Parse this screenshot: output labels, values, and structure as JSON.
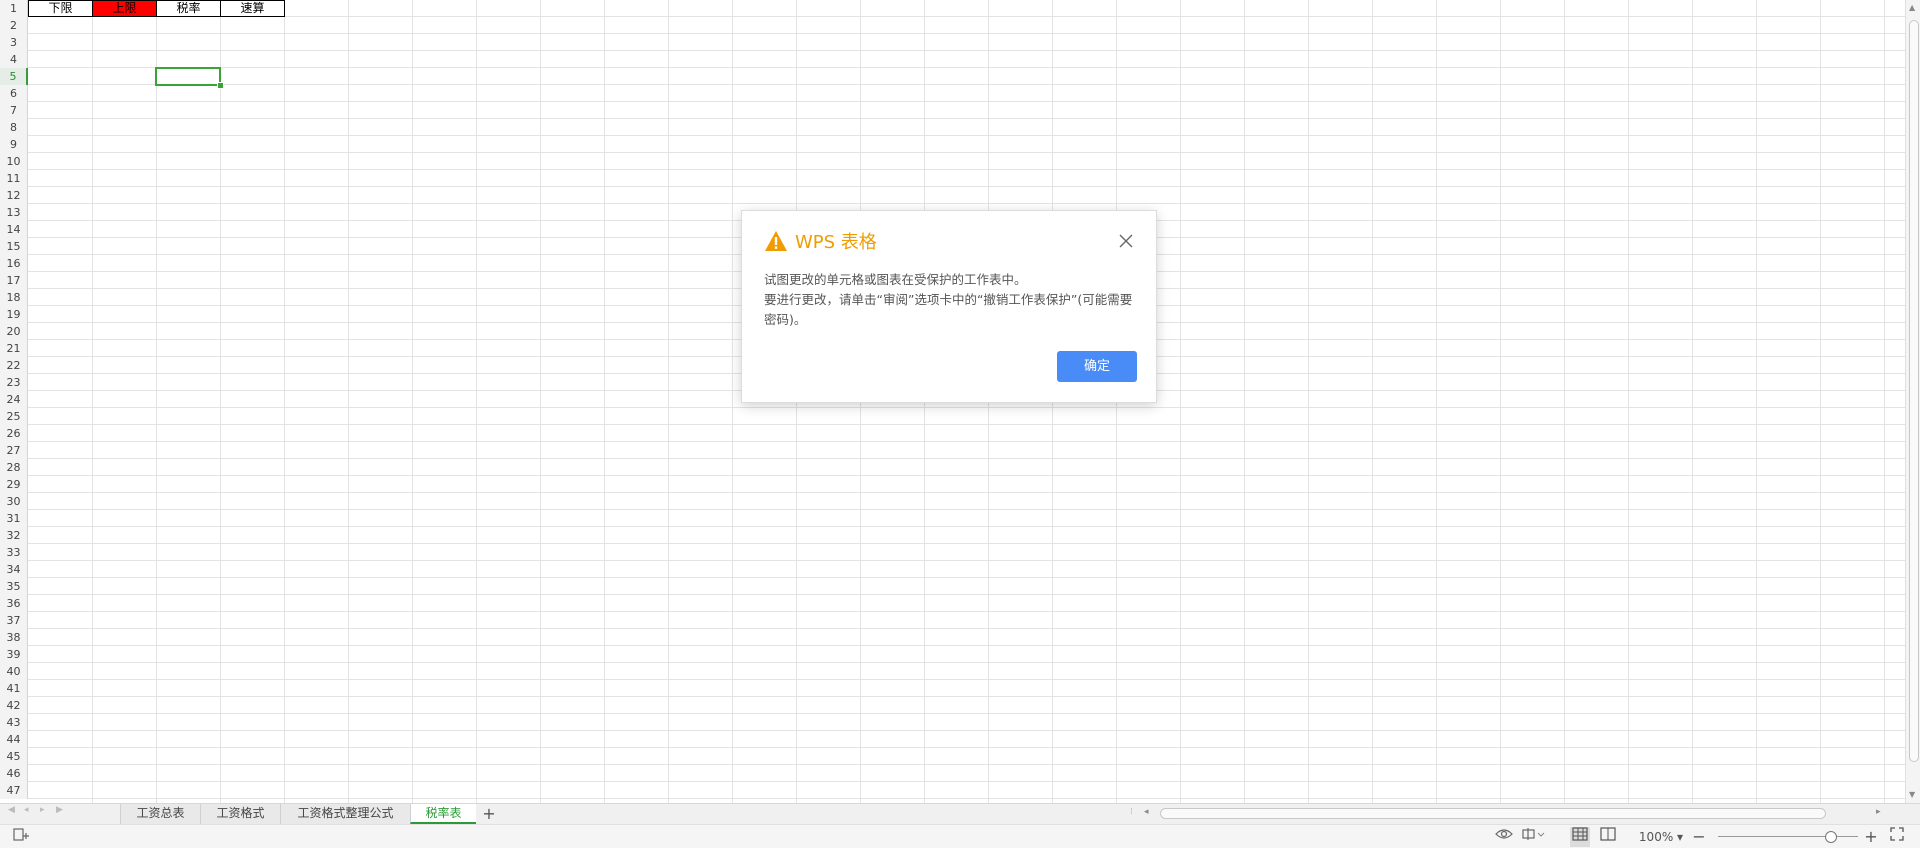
{
  "sheet": {
    "header_cells": [
      "下限",
      "上限",
      "税率",
      "速算"
    ],
    "highlight_color": "#ff0000",
    "row_count": 47,
    "selected_row": 5,
    "selected_column": "C"
  },
  "tabs": [
    "工资总表",
    "工资格式",
    "工资格式整理公式",
    "税率表"
  ],
  "active_tab": "税率表",
  "dialog": {
    "title": "WPS 表格",
    "line1": "试图更改的单元格或图表在受保护的工作表中。",
    "line2": "要进行更改，请单击“审阅”选项卡中的“撤销工作表保护”(可能需要密码)。",
    "ok_label": "确定",
    "icon": "warning-icon",
    "accent": "#f09c00",
    "button_color": "#4a8cf7"
  },
  "statusbar": {
    "zoom": "100%",
    "zoom_level": 1.0
  }
}
